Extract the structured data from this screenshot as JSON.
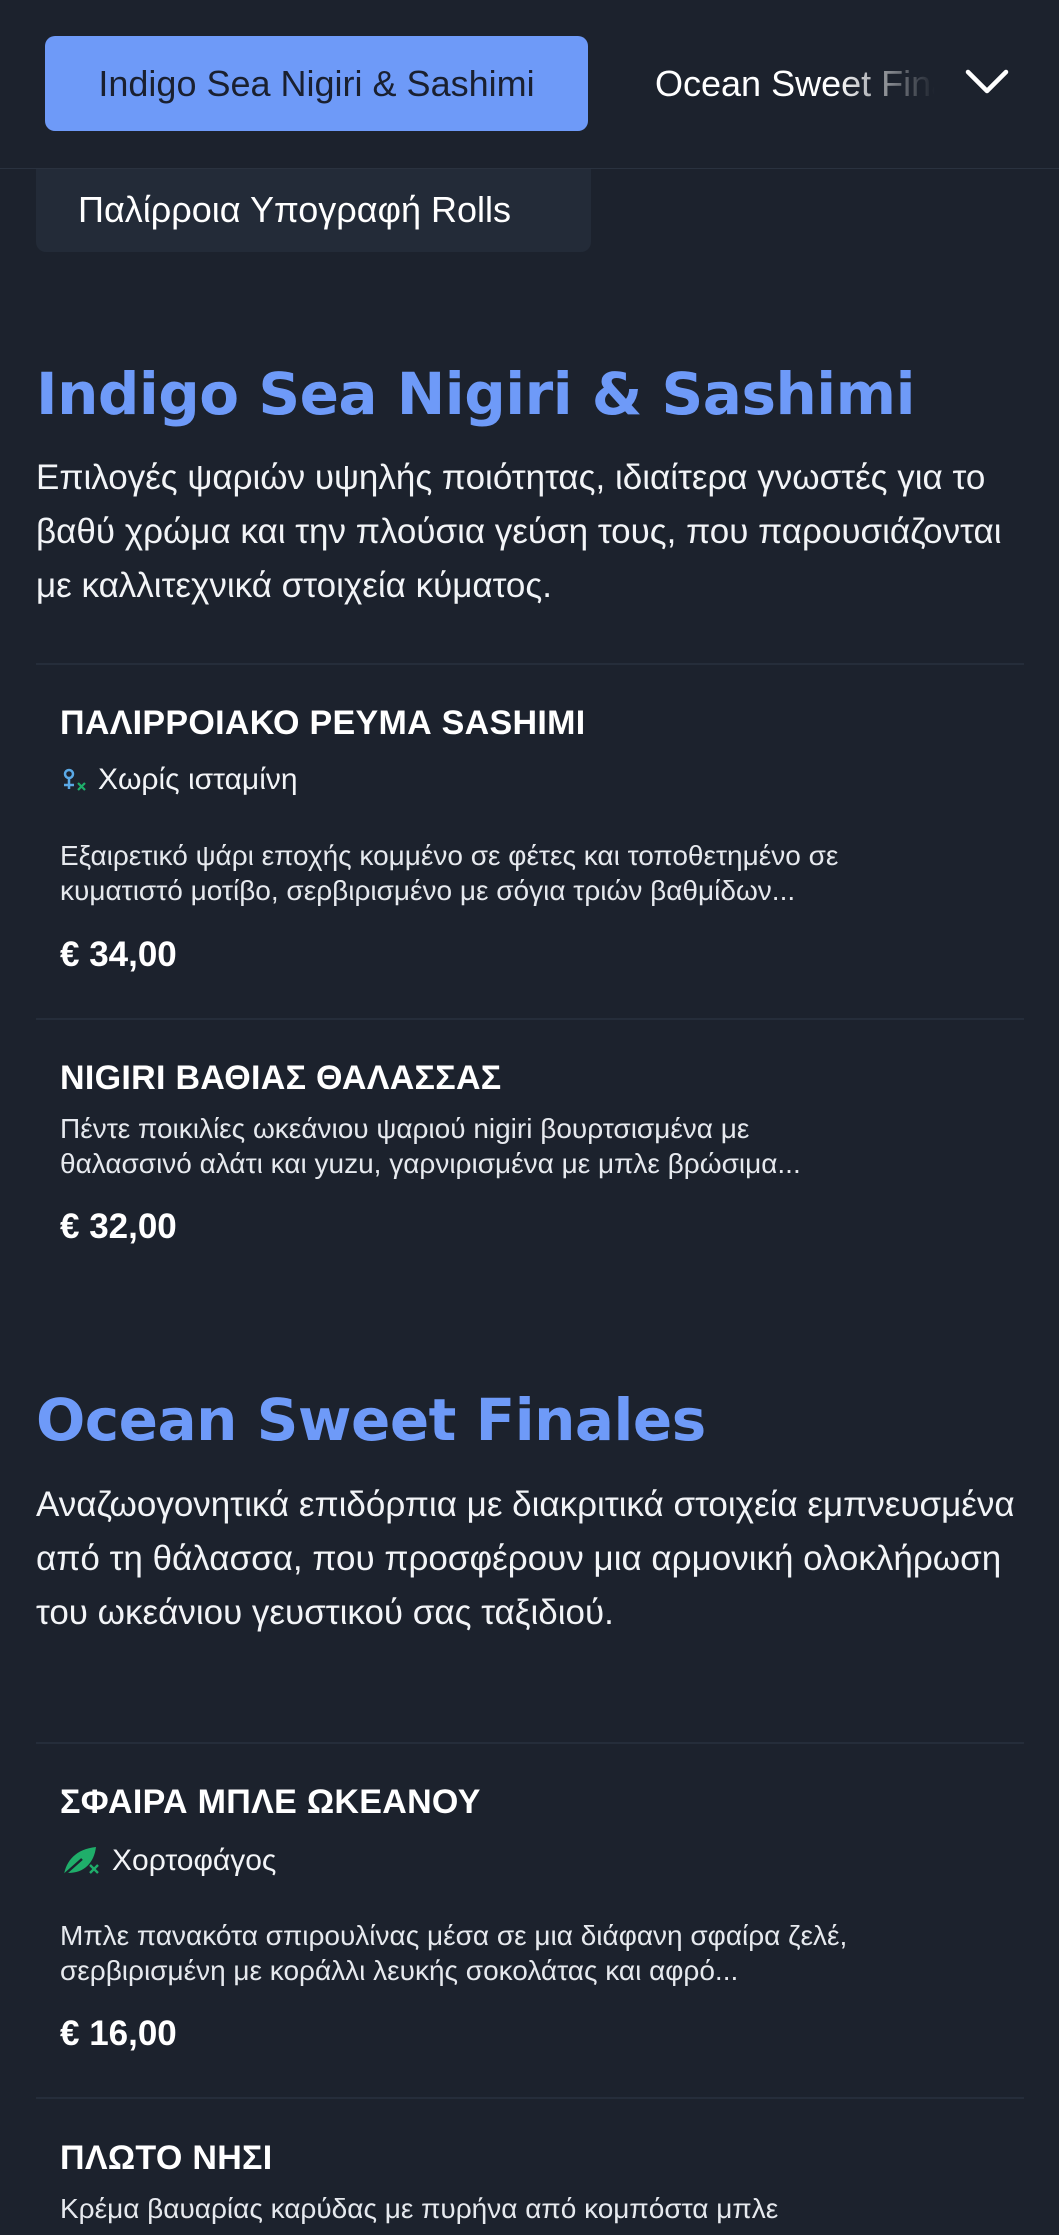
{
  "nav": {
    "active_tab": "Indigo Sea Nigiri & Sashimi",
    "next_tab": "Ocean Sweet Finales",
    "previous_tab": "Παλίρροια Υπογραφή Rolls"
  },
  "sections": [
    {
      "title": "Indigo Sea Nigiri & Sashimi",
      "description": "Επιλογές ψαριών υψηλής ποιότητας, ιδιαίτερα γνωστές για το βαθύ χρώμα και την πλούσια γεύση τους, που παρουσιάζονται με καλλιτεχνικά στοιχεία κύματος.",
      "items": [
        {
          "name": "ΠΑΛΙΡΡΟΙΑΚΟ ΡΕΥΜΑ SASHIMI",
          "tag": "Χωρίς ισταμίνη",
          "tag_icon": "histamine-free-icon",
          "description_line1": "Εξαιρετικό ψάρι εποχής κομμένο σε φέτες και τοποθετημένο σε",
          "description_line2": "κυματιστό μοτίβο, σερβιρισμένο με σόγια τριών βαθμίδων...",
          "price": "€ 34,00"
        },
        {
          "name": "NIGIRI ΒΑΘΙΑΣ ΘΑΛΑΣΣΑΣ",
          "description_line1": "Πέντε ποικιλίες ωκεάνιου ψαριού nigiri βουρτσισμένα με",
          "description_line2": "θαλασσινό αλάτι και yuzu, γαρνιρισμένα με μπλε βρώσιμα...",
          "price": "€ 32,00"
        }
      ]
    },
    {
      "title": "Ocean Sweet Finales",
      "description": "Αναζωογονητικά επιδόρπια με διακριτικά στοιχεία εμπνευσμένα από τη θάλασσα, που προσφέρουν μια αρμονική ολοκλήρωση του ωκεάνιου γευστικού σας ταξιδιού.",
      "items": [
        {
          "name": "ΣΦΑΙΡΑ ΜΠΛΕ ΩΚΕΑΝΟΥ",
          "tag": "Χορτοφάγος",
          "tag_icon": "vegetarian-leaf-icon",
          "description_line1": "Μπλε πανακότα σπιρουλίνας μέσα σε μια διάφανη σφαίρα ζελέ,",
          "description_line2": "σερβιρισμένη με κοράλλι λευκής σοκολάτας και αφρό...",
          "price": "€ 16,00"
        },
        {
          "name": "ΠΛΩΤΟ ΝΗΣΙ",
          "description_line1": "Κρέμα βαυαρίας καρύδας με πυρήνα από κομπόστα μπλε"
        }
      ]
    }
  ],
  "colors": {
    "background": "#1c222d",
    "accent": "#6e9af8",
    "tag_green": "#1fae6a",
    "tag_blue": "#5aa9e6"
  }
}
